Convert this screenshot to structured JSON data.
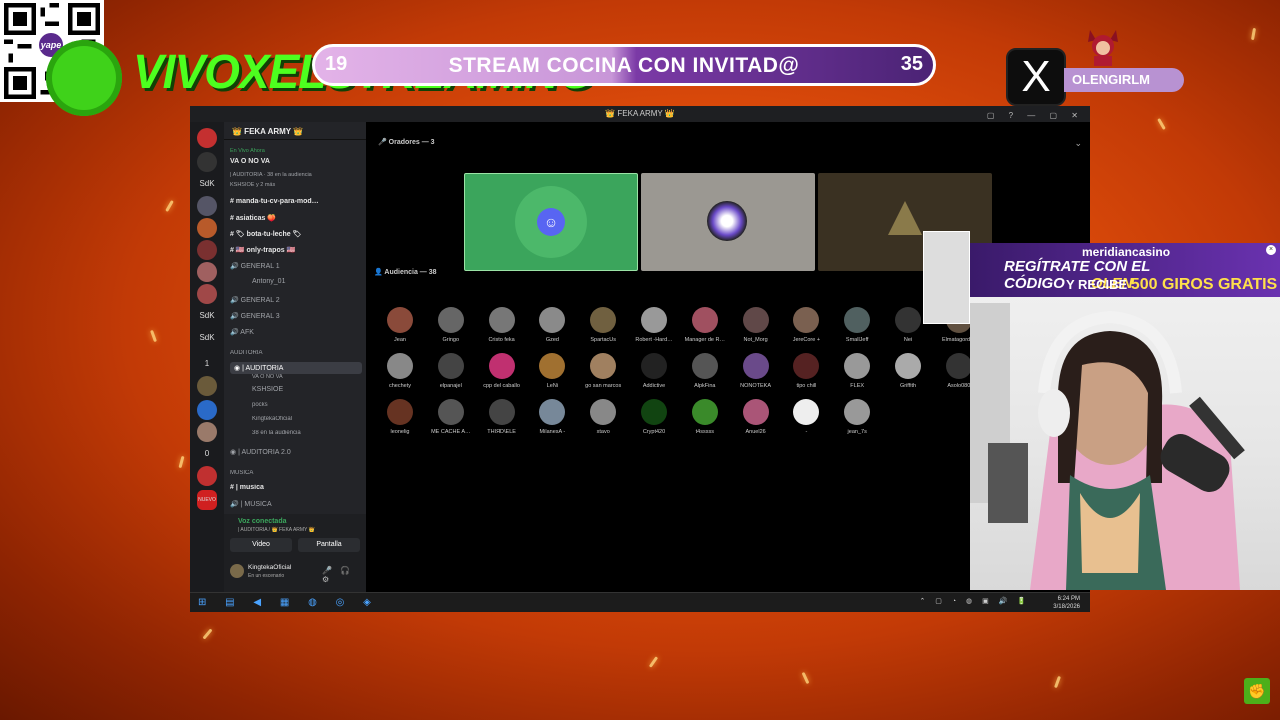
{
  "overlay": {
    "qr_logo": "yape",
    "brand": "VIVOXELSTREAMING",
    "pill": {
      "left_number": "19",
      "title": "STREAM COCINA CON INVITAD@",
      "right_number": "35"
    },
    "x_icon": "X",
    "handle": "OLENGIRLM"
  },
  "window": {
    "title": "👑 FEKA ARMY 👑",
    "server_name": "👑 FEKA ARMY 👑",
    "live_label": "En Vivo Ahora",
    "live_title": "VA O NO VA",
    "live_sub": "| AUDITORIA · 38 en la audiencia",
    "live_sub2": "KSHSIOE y 2 más",
    "guild_labels": [
      "SdK",
      "SdK",
      "SdK",
      "1",
      "0",
      "NUEVO"
    ],
    "channels": [
      "manda-tu-cv-para-mod…",
      "asiaticas 🍑",
      "🏷 bota-tu-leche 🏷",
      "🇺🇸 only-trapos 🇺🇸",
      "GENERAL 1",
      "Antony_01",
      "GENERAL 2",
      "GENERAL 3",
      "AFK",
      "AUDITORIA",
      "| AUDITORIA",
      "VA O NO VA",
      "KSHSIOE",
      "pocks",
      "KingtekaOficial",
      "38 en la audiencia",
      "| AUDITORIA 2.0",
      "MÚSICA",
      "| musica",
      "| MÚSICA"
    ],
    "voice": {
      "status": "Voz conectada",
      "sub": "| AUDITORIA / 👑 FEKA ARMY 👑",
      "video": "Video",
      "screen": "Pantalla"
    },
    "user": {
      "name": "KingtekaOficial",
      "status": "En un escenario"
    },
    "speakers_label": "Oradores — 3",
    "audience_label": "Audiencia — 38",
    "audience": [
      "Jean",
      "Gringo",
      "Cristo feka",
      "Gzed",
      "SpartacUs",
      "Robert -Hard…",
      "Manager de R…",
      "Not_Morg",
      "JereCore +",
      "SmallJeff",
      "Nei",
      "Elmatagord…",
      "chechety",
      "elpanajel",
      "cpp del caballo",
      "LeNi",
      "go san marcos",
      "Addictive",
      "AlpkFina",
      "ÑOÑOTEKA",
      "tipo chill",
      "FLEX",
      "Griffith",
      "Asolo080",
      "leonelig",
      "ME CACHE A…",
      "THIЯD\\ELE",
      "MilanesA -",
      "xtavo",
      "Crypt420",
      "t4sssss",
      "Anuel26",
      "-",
      "jean_7s"
    ],
    "audience_colors": [
      "#8a4a3a",
      "#666",
      "#777",
      "#8a8a8a",
      "#706040",
      "#999",
      "#a05060",
      "#604848",
      "#7a6050",
      "#506060",
      "#333",
      "#605040",
      "#888",
      "#444",
      "#c03070",
      "#a07030",
      "#a08060",
      "#222",
      "#555",
      "#6a4a8a",
      "#552222",
      "#999",
      "#aaa",
      "#333",
      "#663322",
      "#555",
      "#444",
      "#778899",
      "#888",
      "#114411",
      "#3a8a2a",
      "#aa5577",
      "#eee",
      "#999"
    ],
    "clock": {
      "time": "6:24 PM",
      "date": "3/18/2026"
    }
  },
  "ad": {
    "brand": "meridiancasino",
    "line1": "REGÍTRATE CON EL CÓDIGO",
    "code": "OLEN",
    "line2": "Y RECIBE",
    "offer": "500 GIROS GRATIS"
  },
  "colors": {
    "brand_green": "#4dff1f",
    "discord_green": "#3ba55c",
    "pill_purple": "#7b3aa6"
  }
}
